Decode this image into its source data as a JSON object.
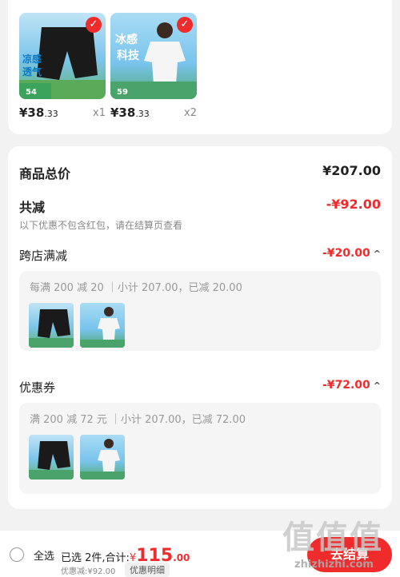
{
  "products": [
    {
      "price_int": "¥38",
      "price_dec": ".33",
      "qty": "x1",
      "badge_text": "✓",
      "image_lines": [
        "凉感",
        "透气"
      ]
    },
    {
      "price_int": "¥38",
      "price_dec": ".33",
      "qty": "x2",
      "badge_text": "✓",
      "image_lines": [
        "冰感",
        "科技"
      ]
    }
  ],
  "summary": {
    "goods_total_label": "商品总价",
    "goods_total_value": "¥207.00",
    "discount_label": "共减",
    "discount_value": "-¥92.00",
    "discount_note": "以下优惠不包含红包，请在结算页查看",
    "cross_store": {
      "label": "跨店满减",
      "value": "-¥20.00",
      "caret": "^",
      "detail": "每满 200 减 20 ｜小计 207.00，已减 20.00"
    },
    "coupon": {
      "label": "优惠券",
      "value": "-¥72.00",
      "caret": "^",
      "detail": "满 200 减 72 元 ｜小计 207.00，已减 72.00"
    }
  },
  "bottom_bar": {
    "select_all": "全选",
    "selected_info": "已选 2件,合计:",
    "total_currency": "¥",
    "total_int": "115",
    "total_dec": ".00",
    "discount_note": "优惠减:¥92.00",
    "detail_button": "优惠明细",
    "checkout_button": "去结算"
  },
  "watermark": {
    "text": "值值值",
    "url": "zhizhizhi.com"
  },
  "colors": {
    "accent": "#f02b2b",
    "background": "#f2f2f2"
  }
}
